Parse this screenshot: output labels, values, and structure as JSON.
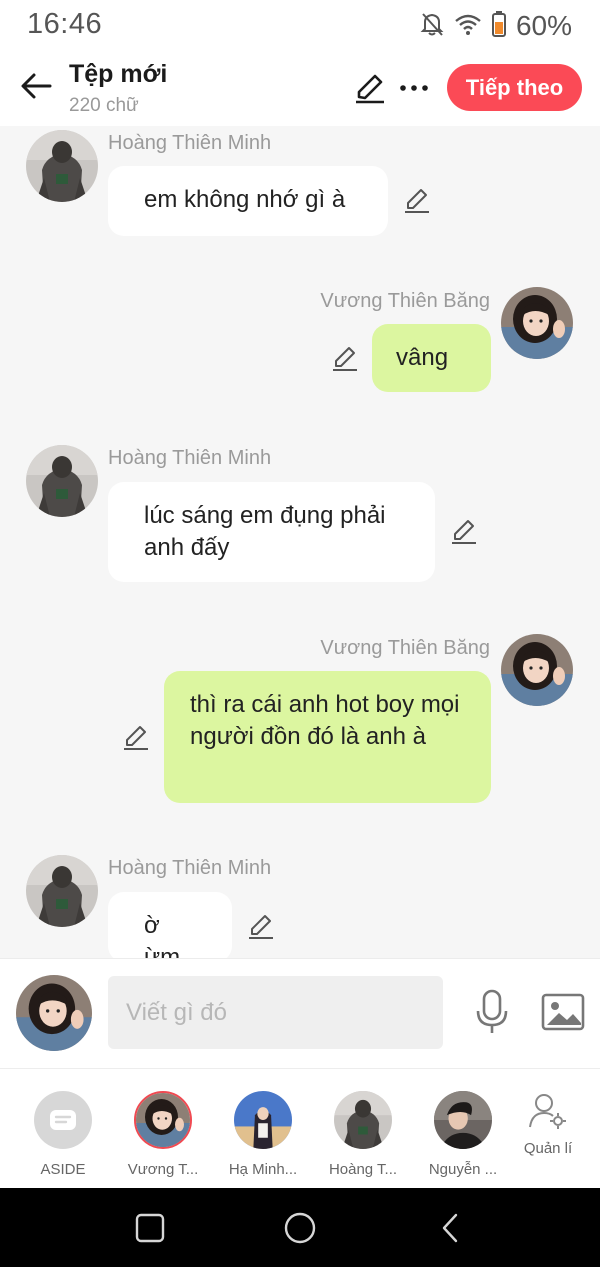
{
  "status": {
    "time": "16:46",
    "battery": "60%"
  },
  "header": {
    "title": "Tệp mới",
    "subtitle": "220 chữ",
    "next_label": "Tiếp theo"
  },
  "messages": [
    {
      "sender": "Hoàng Thiên Minh",
      "text": "em không nhớ gì à",
      "direction": "in"
    },
    {
      "sender": "Vương Thiên Băng",
      "text": "vâng",
      "direction": "out"
    },
    {
      "sender": "Hoàng Thiên Minh",
      "text": "lúc sáng em đụng phải anh đấy",
      "direction": "in"
    },
    {
      "sender": "Vương Thiên Băng",
      "text": "thì ra cái anh hot boy mọi người đồn đó là anh à",
      "direction": "out"
    },
    {
      "sender": "Hoàng Thiên Minh",
      "text": "ờ ừm",
      "direction": "in"
    }
  ],
  "composer": {
    "placeholder": "Viết gì đó"
  },
  "characters": [
    {
      "label": "ASIDE"
    },
    {
      "label": "Vương T..."
    },
    {
      "label": "Hạ Minh..."
    },
    {
      "label": "Hoàng T..."
    },
    {
      "label": "Nguyễn ..."
    }
  ],
  "manage_label": "Quản lí",
  "colors": {
    "accent": "#fb4a56",
    "out_bubble": "#dcf6a0",
    "in_bubble": "#ffffff"
  }
}
